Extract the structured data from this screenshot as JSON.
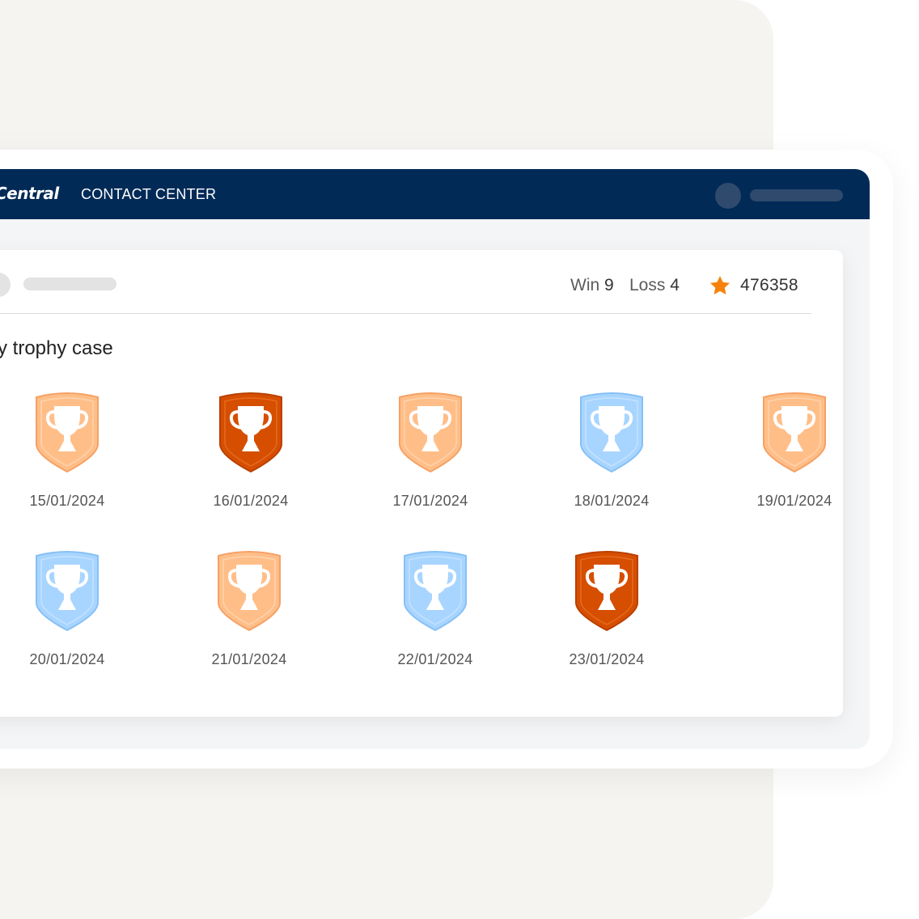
{
  "navbar": {
    "brand": "Central",
    "title": "CONTACT CENTER"
  },
  "stats": {
    "win_label": "Win",
    "win_value": "9",
    "loss_label": "Loss",
    "loss_value": "4",
    "score": "476358",
    "star_color": "#f6820c"
  },
  "section": {
    "title": "My trophy case"
  },
  "colors": {
    "navbar": "#012a57",
    "tier_orange": "#ffbe88",
    "tier_dark_orange": "#d64e00",
    "tier_blue": "#a8d5ff"
  },
  "trophies": [
    {
      "date": "15/01/2024",
      "tier": "light-orange"
    },
    {
      "date": "16/01/2024",
      "tier": "dark-orange"
    },
    {
      "date": "17/01/2024",
      "tier": "light-orange"
    },
    {
      "date": "18/01/2024",
      "tier": "blue"
    },
    {
      "date": "19/01/2024",
      "tier": "light-orange"
    },
    {
      "date": "20/01/2024",
      "tier": "blue"
    },
    {
      "date": "21/01/2024",
      "tier": "light-orange"
    },
    {
      "date": "22/01/2024",
      "tier": "blue"
    },
    {
      "date": "23/01/2024",
      "tier": "dark-orange"
    }
  ]
}
